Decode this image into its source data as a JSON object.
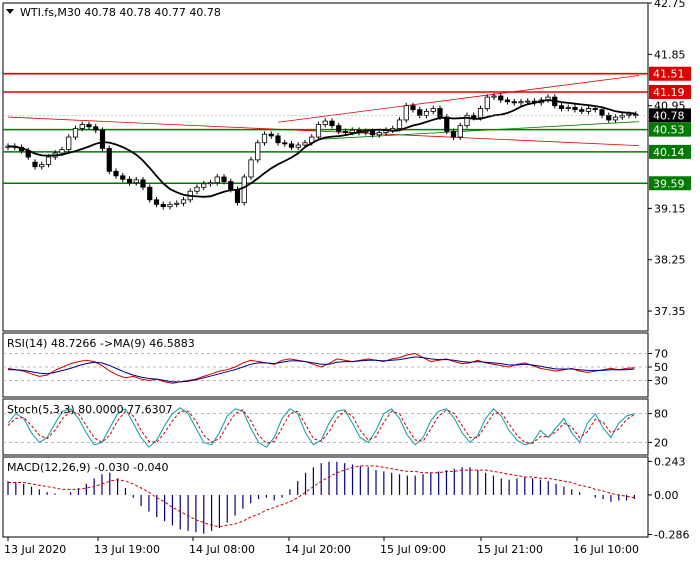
{
  "chart_data": [
    {
      "type": "candlestick",
      "panel": "price",
      "header": "WTI.fs,M30  40.78 40.78 40.77 40.78",
      "symbol": "WTI.fs",
      "timeframe": "M30",
      "ohlc_readout": {
        "open": 40.78,
        "high": 40.78,
        "low": 40.77,
        "close": 40.78
      },
      "last_price": 40.78,
      "ylim": [
        37.0,
        42.75
      ],
      "yticks": [
        "42.75",
        "41.85",
        "40.95",
        "39.15",
        "38.25",
        "37.35"
      ],
      "xticks": [
        "13 Jul 2020",
        "13 Jul 19:00",
        "14 Jul 08:00",
        "14 Jul 20:00",
        "15 Jul 09:00",
        "15 Jul 21:00",
        "16 Jul 10:00"
      ],
      "levels": [
        {
          "value": 41.51,
          "label": "41.51",
          "kind": "resistance",
          "color": "#dd0000"
        },
        {
          "value": 41.19,
          "label": "41.19",
          "kind": "resistance",
          "color": "#dd0000"
        },
        {
          "value": 40.53,
          "label": "40.53",
          "kind": "support",
          "color": "#007a00"
        },
        {
          "value": 40.14,
          "label": "40.14",
          "kind": "support",
          "color": "#007a00"
        },
        {
          "value": 39.59,
          "label": "39.59",
          "kind": "support",
          "color": "#007a00"
        }
      ],
      "trendlines": [
        {
          "name": "channel-upper",
          "color": "#dd0000",
          "from": [
            40.02,
            40.66
          ],
          "to": [
            93.5,
            41.48
          ]
        },
        {
          "name": "channel-lower",
          "color": "#dd0000",
          "from": [
            0,
            40.75
          ],
          "to": [
            93.5,
            40.25
          ]
        },
        {
          "name": "support-trend",
          "color": "#007a00",
          "from": [
            46,
            40.36
          ],
          "to": [
            93.5,
            40.67
          ]
        }
      ],
      "candles_approx": [
        [
          40.22,
          40.24
        ],
        [
          40.24,
          40.22
        ],
        [
          40.22,
          40.16
        ],
        [
          40.16,
          40.05
        ],
        [
          39.96,
          39.88
        ],
        [
          39.88,
          39.92
        ],
        [
          39.92,
          40.05
        ],
        [
          40.05,
          40.12
        ],
        [
          40.12,
          40.18
        ],
        [
          40.18,
          40.4
        ],
        [
          40.4,
          40.55
        ],
        [
          40.55,
          40.62
        ],
        [
          40.62,
          40.58
        ],
        [
          40.58,
          40.52
        ],
        [
          40.52,
          40.2
        ],
        [
          40.2,
          39.8
        ],
        [
          39.8,
          39.72
        ],
        [
          39.72,
          39.66
        ],
        [
          39.66,
          39.6
        ],
        [
          39.6,
          39.65
        ],
        [
          39.65,
          39.52
        ],
        [
          39.52,
          39.3
        ],
        [
          39.3,
          39.22
        ],
        [
          39.22,
          39.18
        ],
        [
          39.18,
          39.22
        ],
        [
          39.22,
          39.24
        ],
        [
          39.24,
          39.3
        ],
        [
          39.3,
          39.45
        ],
        [
          39.45,
          39.52
        ],
        [
          39.52,
          39.58
        ],
        [
          39.58,
          39.6
        ],
        [
          39.6,
          39.7
        ],
        [
          39.7,
          39.62
        ],
        [
          39.62,
          39.48
        ],
        [
          39.48,
          39.25
        ],
        [
          39.25,
          39.7
        ],
        [
          39.7,
          40.0
        ],
        [
          40.0,
          40.3
        ],
        [
          40.3,
          40.45
        ],
        [
          40.45,
          40.42
        ],
        [
          40.42,
          40.3
        ],
        [
          40.3,
          40.28
        ],
        [
          40.28,
          40.22
        ],
        [
          40.22,
          40.26
        ],
        [
          40.26,
          40.3
        ],
        [
          40.3,
          40.4
        ],
        [
          40.4,
          40.62
        ],
        [
          40.62,
          40.68
        ],
        [
          40.68,
          40.6
        ],
        [
          40.6,
          40.5
        ],
        [
          40.5,
          40.48
        ],
        [
          40.48,
          40.52
        ],
        [
          40.52,
          40.48
        ],
        [
          40.48,
          40.5
        ],
        [
          40.5,
          40.44
        ],
        [
          40.44,
          40.48
        ],
        [
          40.48,
          40.52
        ],
        [
          40.52,
          40.55
        ],
        [
          40.55,
          40.7
        ],
        [
          40.7,
          40.95
        ],
        [
          40.95,
          40.88
        ],
        [
          40.88,
          40.78
        ],
        [
          40.78,
          40.85
        ],
        [
          40.85,
          40.9
        ],
        [
          40.9,
          40.75
        ],
        [
          40.75,
          40.5
        ],
        [
          40.5,
          40.4
        ],
        [
          40.4,
          40.6
        ],
        [
          40.6,
          40.78
        ],
        [
          40.78,
          40.74
        ],
        [
          40.74,
          40.9
        ],
        [
          40.9,
          41.1
        ],
        [
          41.1,
          41.12
        ],
        [
          41.12,
          41.05
        ],
        [
          41.05,
          41.02
        ],
        [
          41.02,
          41.0
        ],
        [
          41.0,
          41.02
        ],
        [
          41.02,
          41.03
        ],
        [
          41.03,
          41.0
        ],
        [
          41.0,
          41.05
        ],
        [
          41.05,
          41.1
        ],
        [
          41.1,
          40.95
        ],
        [
          40.95,
          40.9
        ],
        [
          40.9,
          40.92
        ],
        [
          40.92,
          40.88
        ],
        [
          40.88,
          40.85
        ],
        [
          40.85,
          40.9
        ],
        [
          40.9,
          40.88
        ],
        [
          40.88,
          40.78
        ],
        [
          40.78,
          40.7
        ],
        [
          40.7,
          40.75
        ],
        [
          40.75,
          40.78
        ],
        [
          40.78,
          40.8
        ],
        [
          40.8,
          40.78
        ]
      ],
      "ma_color": "#000000"
    },
    {
      "type": "line",
      "panel": "rsi",
      "header": "RSI(14) 48.7266   ->MA(9) 46.5883",
      "rsi_value": 48.7266,
      "ma_value": 46.5883,
      "levels": [
        "70",
        "50",
        "30"
      ],
      "ylim": [
        10,
        90
      ],
      "series": [
        {
          "color": "#d00000",
          "values": [
            48,
            46,
            44,
            40,
            36,
            38,
            45,
            50,
            55,
            58,
            60,
            58,
            52,
            44,
            38,
            34,
            36,
            32,
            30,
            32,
            28,
            26,
            28,
            30,
            32,
            36,
            40,
            44,
            46,
            50,
            56,
            60,
            58,
            56,
            54,
            60,
            62,
            60,
            58,
            54,
            50,
            55,
            62,
            60,
            58,
            60,
            62,
            60,
            58,
            62,
            64,
            68,
            70,
            64,
            58,
            60,
            62,
            58,
            55,
            56,
            60,
            56,
            54,
            52,
            50,
            54,
            56,
            52,
            48,
            46,
            44,
            46,
            48,
            44,
            42,
            44,
            46,
            48,
            46,
            48,
            49
          ]
        },
        {
          "color": "#000080",
          "values": [
            46,
            46,
            45,
            43,
            41,
            40,
            42,
            45,
            48,
            52,
            55,
            57,
            56,
            52,
            47,
            42,
            38,
            35,
            33,
            32,
            30,
            28,
            28,
            29,
            31,
            34,
            37,
            40,
            43,
            46,
            50,
            54,
            56,
            56,
            55,
            57,
            59,
            59,
            58,
            56,
            54,
            54,
            57,
            58,
            58,
            59,
            60,
            60,
            59,
            60,
            61,
            63,
            65,
            64,
            62,
            61,
            61,
            60,
            58,
            57,
            58,
            57,
            56,
            55,
            53,
            53,
            54,
            53,
            51,
            49,
            47,
            47,
            47,
            46,
            45,
            45,
            45,
            46,
            46,
            46,
            47
          ]
        }
      ]
    },
    {
      "type": "line",
      "panel": "stochastic",
      "header": "Stoch(5,3,3) 80.0000 77.6307",
      "k_value": 80.0,
      "d_value": 77.6307,
      "levels": [
        "80",
        "20"
      ],
      "ylim": [
        0,
        100
      ],
      "series": [
        {
          "color": "#0d9aa5",
          "values": [
            60,
            80,
            70,
            40,
            20,
            30,
            60,
            85,
            90,
            70,
            40,
            15,
            20,
            50,
            80,
            90,
            60,
            30,
            10,
            25,
            55,
            80,
            92,
            80,
            50,
            20,
            15,
            40,
            75,
            90,
            85,
            50,
            20,
            10,
            30,
            70,
            90,
            80,
            40,
            15,
            25,
            60,
            85,
            88,
            60,
            30,
            20,
            45,
            80,
            90,
            70,
            35,
            15,
            30,
            65,
            85,
            90,
            70,
            40,
            20,
            35,
            70,
            90,
            75,
            45,
            25,
            15,
            20,
            45,
            30,
            50,
            70,
            40,
            20,
            60,
            80,
            50,
            30,
            60,
            75,
            80
          ]
        },
        {
          "color": "#d00000",
          "dashed": true,
          "values": [
            55,
            70,
            72,
            55,
            35,
            28,
            45,
            70,
            85,
            80,
            55,
            30,
            20,
            35,
            65,
            85,
            75,
            45,
            22,
            20,
            40,
            65,
            85,
            85,
            65,
            35,
            20,
            28,
            55,
            80,
            88,
            65,
            35,
            18,
            22,
            50,
            80,
            85,
            58,
            28,
            22,
            42,
            70,
            85,
            75,
            45,
            25,
            32,
            62,
            85,
            80,
            50,
            25,
            22,
            48,
            75,
            88,
            80,
            55,
            30,
            30,
            55,
            80,
            82,
            58,
            35,
            20,
            18,
            32,
            32,
            42,
            60,
            52,
            30,
            42,
            68,
            62,
            40,
            48,
            68,
            78
          ]
        }
      ]
    },
    {
      "type": "bar",
      "panel": "macd",
      "header": "MACD(12,26,9) -0.030 -0.040",
      "macd_value": -0.03,
      "signal_value": -0.04,
      "yticks": [
        "0.243",
        "0.00",
        "-0.286"
      ],
      "ylim": [
        -0.29,
        0.26
      ],
      "bar_color": "#000080",
      "signal_color": "#d00000",
      "values": [
        0.1,
        0.09,
        0.08,
        0.06,
        0.04,
        0.02,
        0.01,
        0.0,
        0.02,
        0.05,
        0.08,
        0.12,
        0.15,
        0.16,
        0.12,
        0.05,
        -0.02,
        -0.08,
        -0.12,
        -0.16,
        -0.19,
        -0.22,
        -0.25,
        -0.26,
        -0.27,
        -0.28,
        -0.26,
        -0.24,
        -0.2,
        -0.15,
        -0.1,
        -0.06,
        -0.03,
        -0.02,
        -0.04,
        -0.02,
        0.04,
        0.1,
        0.16,
        0.2,
        0.23,
        0.24,
        0.24,
        0.23,
        0.22,
        0.21,
        0.2,
        0.18,
        0.17,
        0.16,
        0.15,
        0.14,
        0.14,
        0.15,
        0.16,
        0.17,
        0.18,
        0.19,
        0.2,
        0.2,
        0.18,
        0.16,
        0.14,
        0.12,
        0.11,
        0.12,
        0.13,
        0.12,
        0.11,
        0.1,
        0.08,
        0.06,
        0.04,
        0.02,
        0.0,
        -0.02,
        -0.03,
        -0.05,
        -0.04,
        -0.04,
        -0.03
      ],
      "signal": [
        0.09,
        0.09,
        0.09,
        0.08,
        0.07,
        0.06,
        0.05,
        0.04,
        0.04,
        0.04,
        0.05,
        0.06,
        0.08,
        0.1,
        0.11,
        0.1,
        0.08,
        0.05,
        0.02,
        -0.02,
        -0.05,
        -0.09,
        -0.12,
        -0.15,
        -0.18,
        -0.2,
        -0.22,
        -0.23,
        -0.22,
        -0.21,
        -0.19,
        -0.16,
        -0.14,
        -0.11,
        -0.09,
        -0.07,
        -0.05,
        -0.02,
        0.02,
        0.06,
        0.1,
        0.13,
        0.16,
        0.18,
        0.2,
        0.21,
        0.21,
        0.21,
        0.2,
        0.19,
        0.18,
        0.17,
        0.17,
        0.16,
        0.16,
        0.16,
        0.17,
        0.17,
        0.18,
        0.18,
        0.18,
        0.18,
        0.17,
        0.16,
        0.15,
        0.14,
        0.13,
        0.13,
        0.12,
        0.12,
        0.11,
        0.1,
        0.09,
        0.07,
        0.06,
        0.04,
        0.03,
        0.01,
        0.0,
        -0.01,
        -0.02
      ]
    }
  ]
}
